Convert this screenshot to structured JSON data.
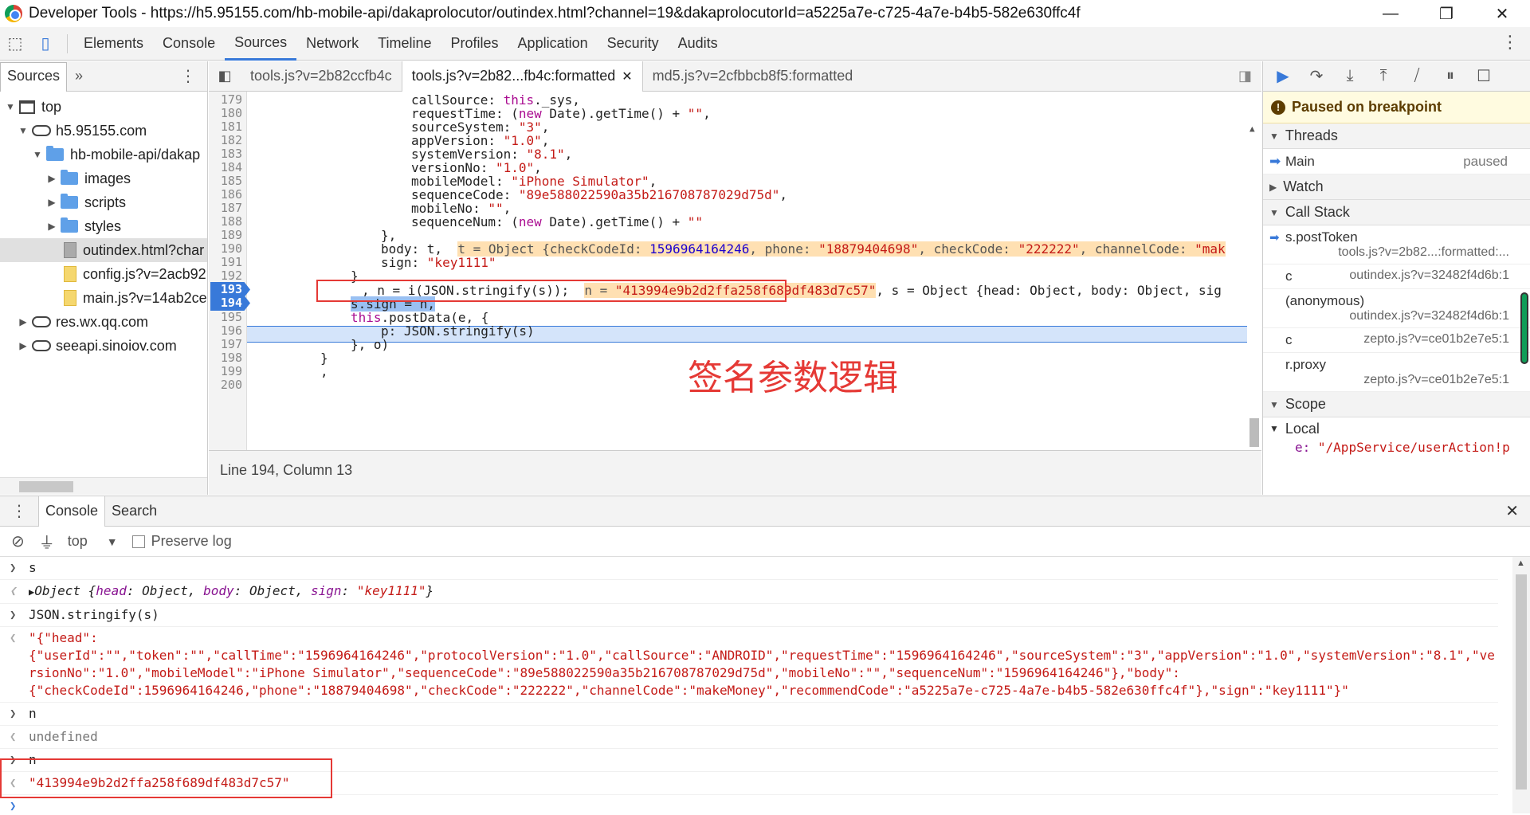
{
  "window": {
    "title": "Developer Tools - https://h5.95155.com/hb-mobile-api/dakaprolocutor/outindex.html?channel=19&dakaprolocutorId=a5225a7e-c725-4a7e-b4b5-582e630ffc4f"
  },
  "main_tabs": [
    "Elements",
    "Console",
    "Sources",
    "Network",
    "Timeline",
    "Profiles",
    "Application",
    "Security",
    "Audits"
  ],
  "navigator": {
    "tab": "Sources",
    "items": {
      "top": "top",
      "domain": "h5.95155.com",
      "folder": "hb-mobile-api/dakap",
      "images": "images",
      "scripts": "scripts",
      "styles": "styles",
      "outindex": "outindex.html?char",
      "config": "config.js?v=2acb92",
      "main": "main.js?v=14ab2ce",
      "res": "res.wx.qq.com",
      "see": "seeapi.sinoiov.com"
    }
  },
  "editor": {
    "tabs": [
      "tools.js?v=2b82ccfb4c",
      "tools.js?v=2b82...fb4c:formatted",
      "md5.js?v=2cfbbcb8f5:formatted"
    ],
    "status": "Line 194, Column 13",
    "annotation": "签名参数逻辑",
    "lines": {
      "n179": "179",
      "n180": "180",
      "n181": "181",
      "n182": "182",
      "n183": "183",
      "n184": "184",
      "n185": "185",
      "n186": "186",
      "n187": "187",
      "n188": "188",
      "n189": "189",
      "n190": "190",
      "n191": "191",
      "n192": "192",
      "n193": "193",
      "n194": "194",
      "n195": "195",
      "n196": "196",
      "n197": "197",
      "n198": "198",
      "n199": "199",
      "n200": "200",
      "l179a": "callSource: ",
      "l179b": "this",
      "l179c": "._sys,",
      "l180a": "requestTime: (",
      "l180b": "new",
      "l180c": " Date).getTime() + ",
      "l180d": "\"\"",
      "l181a": "sourceSystem: ",
      "l181b": "\"3\"",
      "l182a": "appVersion: ",
      "l182b": "\"1.0\"",
      "l183a": "systemVersion: ",
      "l183b": "\"8.1\"",
      "l184a": "versionNo: ",
      "l184b": "\"1.0\"",
      "l185a": "mobileModel: ",
      "l185b": "\"iPhone Simulator\"",
      "l186a": "sequenceCode: ",
      "l186b": "\"89e588022590a35b216708787029d75d\"",
      "l187a": "mobileNo: ",
      "l187b": "\"\"",
      "l188a": "sequenceNum: (",
      "l188b": "new",
      "l188c": " Date).getTime() + ",
      "l188d": "\"\"",
      "l189": "},",
      "l190a": "body: t,  ",
      "l190b": "t = Object {checkCodeId: ",
      "l190c": "1596964164246",
      "l190d": ", phone: ",
      "l190e": "\"18879404698\"",
      "l190f": ", checkCode: ",
      "l190g": "\"222222\"",
      "l190h": ", channelCode: ",
      "l190i": "\"mak",
      "l191a": "sign: ",
      "l191b": "\"key1111\"",
      "l192": "}",
      "l193a": ", n = i(JSON.stringify(s));  ",
      "l193b": "n = ",
      "l193c": "\"413994e9b2d2ffa258f689df483d7c57\"",
      "l193d": ", s = Object {head: Object, body: Object, sig",
      "l194": "s.sign = n,",
      "l195a": "this",
      "l195b": ".postData(e, {",
      "l196": "p: JSON.stringify(s)",
      "l197": "}, o)",
      "l198": "}",
      "l199": ","
    }
  },
  "debugger": {
    "paused": "Paused on breakpoint",
    "threads": "Threads",
    "main": "Main",
    "main_state": "paused",
    "watch": "Watch",
    "call_stack": "Call Stack",
    "frames": [
      {
        "fn": "s.postToken",
        "loc": "tools.js?v=2b82...:formatted:..."
      },
      {
        "fn": "c",
        "loc": "outindex.js?v=32482f4d6b:1"
      },
      {
        "fn": "(anonymous)",
        "loc": "outindex.js?v=32482f4d6b:1"
      },
      {
        "fn": "c",
        "loc": "zepto.js?v=ce01b2e7e5:1"
      },
      {
        "fn": "r.proxy",
        "loc": "zepto.js?v=ce01b2e7e5:1"
      }
    ],
    "scope": "Scope",
    "local": "Local",
    "local_e_key": "e: ",
    "local_e_val": "\"/AppService/userAction!p"
  },
  "console": {
    "tabs": [
      "Console",
      "Search"
    ],
    "context": "top",
    "preserve_log": "Preserve log",
    "m1": "s",
    "m2a": "Object {",
    "m2b": "head",
    "m2c": ": Object, ",
    "m2d": "body",
    "m2e": ": Object, ",
    "m2f": "sign",
    "m2g": ": ",
    "m2h": "\"key1111\"",
    "m2i": "}",
    "m3": "JSON.stringify(s)",
    "m4": "\"{\"head\":\n{\"userId\":\"\",\"token\":\"\",\"callTime\":\"1596964164246\",\"protocolVersion\":\"1.0\",\"callSource\":\"ANDROID\",\"requestTime\":\"1596964164246\",\"sourceSystem\":\"3\",\"appVersion\":\"1.0\",\"systemVersion\":\"8.1\",\"versionNo\":\"1.0\",\"mobileModel\":\"iPhone Simulator\",\"sequenceCode\":\"89e588022590a35b216708787029d75d\",\"mobileNo\":\"\",\"sequenceNum\":\"1596964164246\"},\"body\":\n{\"checkCodeId\":1596964164246,\"phone\":\"18879404698\",\"checkCode\":\"222222\",\"channelCode\":\"makeMoney\",\"recommendCode\":\"a5225a7e-c725-4a7e-b4b5-582e630ffc4f\"},\"sign\":\"key1111\"}\"",
    "m5": "n",
    "m6": "undefined",
    "m7": "n",
    "m8": "\"413994e9b2d2ffa258f689df483d7c57\""
  }
}
